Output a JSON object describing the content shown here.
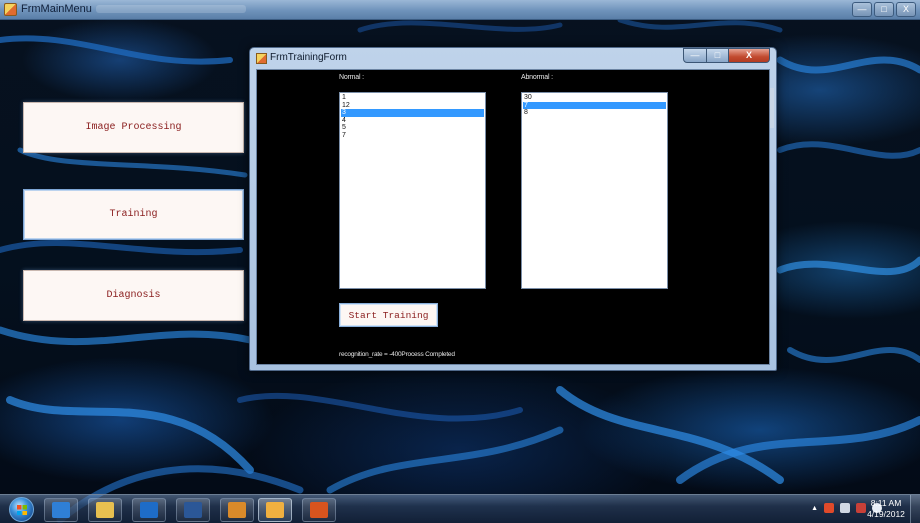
{
  "main_window": {
    "title": "FrmMainMenu",
    "controls": {
      "minimize": "—",
      "maximize": "□",
      "close": "X"
    }
  },
  "nav": [
    {
      "label": "Image Processing",
      "name": "image-processing-button"
    },
    {
      "label": "Training",
      "name": "training-button"
    },
    {
      "label": "Diagnosis",
      "name": "diagnosis-button"
    }
  ],
  "training_form": {
    "title": "FrmTrainingForm",
    "controls": {
      "minimize": "—",
      "maximize": "□",
      "close": "X"
    },
    "normal_label": "Normal :",
    "abnormal_label": "Abnormal :",
    "normal_items": [
      "1",
      "12",
      "3",
      "4",
      "5",
      "7"
    ],
    "normal_selected": "3",
    "abnormal_items": [
      "30",
      "7",
      "8"
    ],
    "abnormal_selected": "7",
    "start_button": "Start Training",
    "status": "recognition_rate = -400Process Completed"
  },
  "taskbar": {
    "apps": [
      {
        "name": "ie-icon",
        "color": "#2f7fd6",
        "running": false
      },
      {
        "name": "explorer-folder-icon",
        "color": "#e8c050",
        "running": false
      },
      {
        "name": "outlook-icon",
        "color": "#1e6cc8",
        "running": false
      },
      {
        "name": "word-icon",
        "color": "#2b5797",
        "running": false
      },
      {
        "name": "network-app-icon",
        "color": "#d98a2a",
        "running": false
      },
      {
        "name": "frmmainmenu-app-icon",
        "color": "#f0b040",
        "running": true
      },
      {
        "name": "matlab-icon",
        "color": "#d8541e",
        "running": false
      }
    ],
    "clock_time": "8:11 AM",
    "clock_date": "4/19/2012"
  },
  "colors": {
    "accent_blue": "#3399ff",
    "button_text": "#8a1d1d",
    "form_background": "#000000"
  }
}
